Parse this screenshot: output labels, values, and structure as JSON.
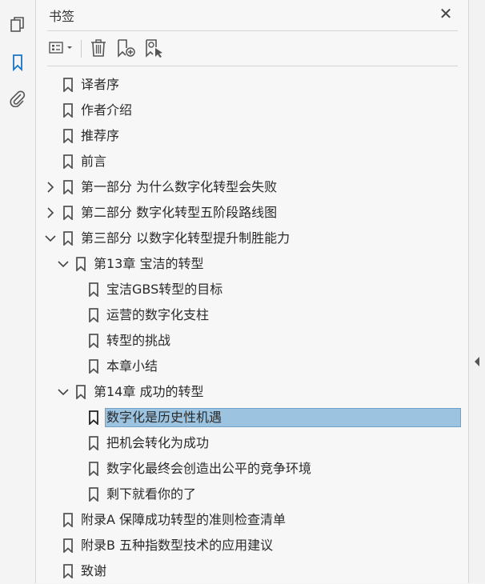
{
  "panel": {
    "title": "书签"
  },
  "bookmarks": [
    {
      "label": "译者序",
      "level": 0,
      "chevron": "none"
    },
    {
      "label": "作者介绍",
      "level": 0,
      "chevron": "none"
    },
    {
      "label": "推荐序",
      "level": 0,
      "chevron": "none"
    },
    {
      "label": "前言",
      "level": 0,
      "chevron": "none"
    },
    {
      "label": "第一部分 为什么数字化转型会失败",
      "level": 0,
      "chevron": "collapsed"
    },
    {
      "label": "第二部分 数字化转型五阶段路线图",
      "level": 0,
      "chevron": "collapsed"
    },
    {
      "label": "第三部分 以数字化转型提升制胜能力",
      "level": 0,
      "chevron": "expanded"
    },
    {
      "label": "第13章 宝洁的转型",
      "level": 1,
      "chevron": "expanded"
    },
    {
      "label": "宝洁GBS转型的目标",
      "level": 2,
      "chevron": "none"
    },
    {
      "label": "运营的数字化支柱",
      "level": 2,
      "chevron": "none"
    },
    {
      "label": "转型的挑战",
      "level": 2,
      "chevron": "none"
    },
    {
      "label": "本章小结",
      "level": 2,
      "chevron": "none"
    },
    {
      "label": "第14章 成功的转型",
      "level": 1,
      "chevron": "expanded"
    },
    {
      "label": "数字化是历史性机遇",
      "level": 2,
      "chevron": "none",
      "selected": true
    },
    {
      "label": "把机会转化为成功",
      "level": 2,
      "chevron": "none"
    },
    {
      "label": "数字化最终会创造出公平的竞争环境",
      "level": 2,
      "chevron": "none"
    },
    {
      "label": "剩下就看你的了",
      "level": 2,
      "chevron": "none"
    },
    {
      "label": "附录A 保障成功转型的准则检查清单",
      "level": 0,
      "chevron": "none"
    },
    {
      "label": "附录B 五种指数型技术的应用建议",
      "level": 0,
      "chevron": "none"
    },
    {
      "label": "致谢",
      "level": 0,
      "chevron": "none"
    }
  ],
  "colors": {
    "accent": "#1a73c9",
    "selection": "#9cc3e0"
  }
}
